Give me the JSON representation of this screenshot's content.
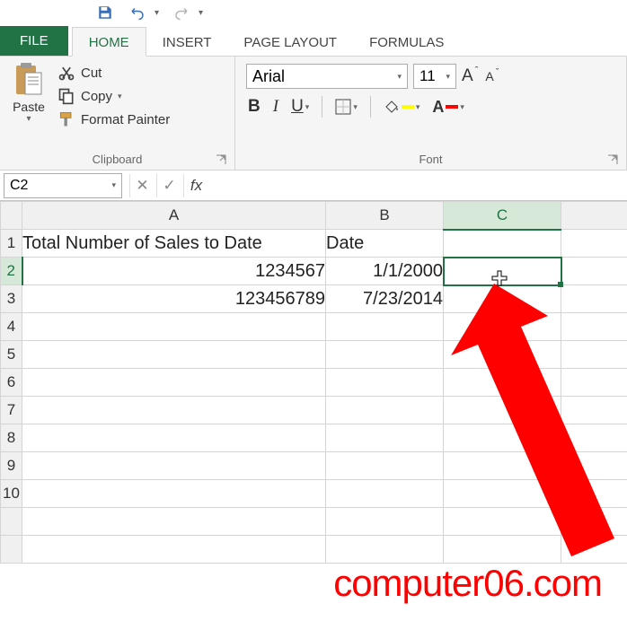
{
  "qat": {
    "dropdown_glyph": "▾"
  },
  "tabs": {
    "file": "FILE",
    "home": "HOME",
    "insert": "INSERT",
    "page_layout": "PAGE LAYOUT",
    "formulas": "FORMULAS"
  },
  "ribbon": {
    "clipboard": {
      "title": "Clipboard",
      "paste": "Paste",
      "cut": "Cut",
      "copy": "Copy",
      "format_painter": "Format Painter"
    },
    "font": {
      "title": "Font",
      "name": "Arial",
      "size": "11",
      "bold": "B",
      "italic": "I",
      "underline": "U",
      "grow": "A",
      "shrink": "A",
      "fill_char": "A",
      "color_char": "A"
    }
  },
  "name_box": "C2",
  "fx_label": "fx",
  "formula_value": "",
  "columns": {
    "a": "A",
    "b": "B",
    "c": "C"
  },
  "rows": [
    "1",
    "2",
    "3",
    "4",
    "5",
    "6",
    "7",
    "8",
    "9",
    "10"
  ],
  "cells": {
    "a1": "Total Number of Sales to Date",
    "b1": "Date",
    "a2": "1234567",
    "b2": "1/1/2000",
    "a3": "123456789",
    "b3": "7/23/2014"
  },
  "watermark": "computer06.com",
  "colors": {
    "excel_green": "#217346",
    "accent_red": "#ff0000",
    "highlight_yellow": "#ffff00"
  }
}
